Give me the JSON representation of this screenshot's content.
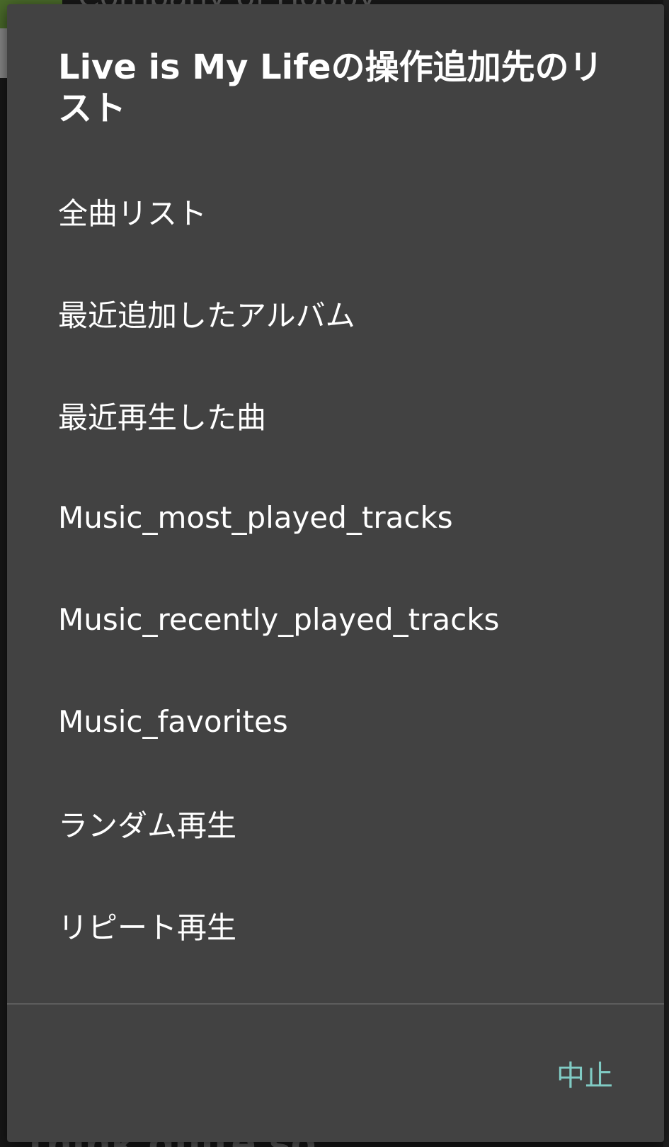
{
  "background": {
    "top_text": "Company of Hobby",
    "bottom_text": "think quite so"
  },
  "dialog": {
    "title": "Live is My Lifeの操作追加先のリスト",
    "items": [
      {
        "label": "全曲リスト"
      },
      {
        "label": "最近追加したアルバム"
      },
      {
        "label": "最近再生した曲"
      },
      {
        "label": "Music_most_played_tracks"
      },
      {
        "label": "Music_recently_played_tracks"
      },
      {
        "label": "Music_favorites"
      },
      {
        "label": "ランダム再生"
      },
      {
        "label": "リピート再生"
      }
    ],
    "cancel_label": "中止"
  },
  "colors": {
    "dialog_background": "#424242",
    "accent": "#80cbc4",
    "text": "#ffffff"
  }
}
